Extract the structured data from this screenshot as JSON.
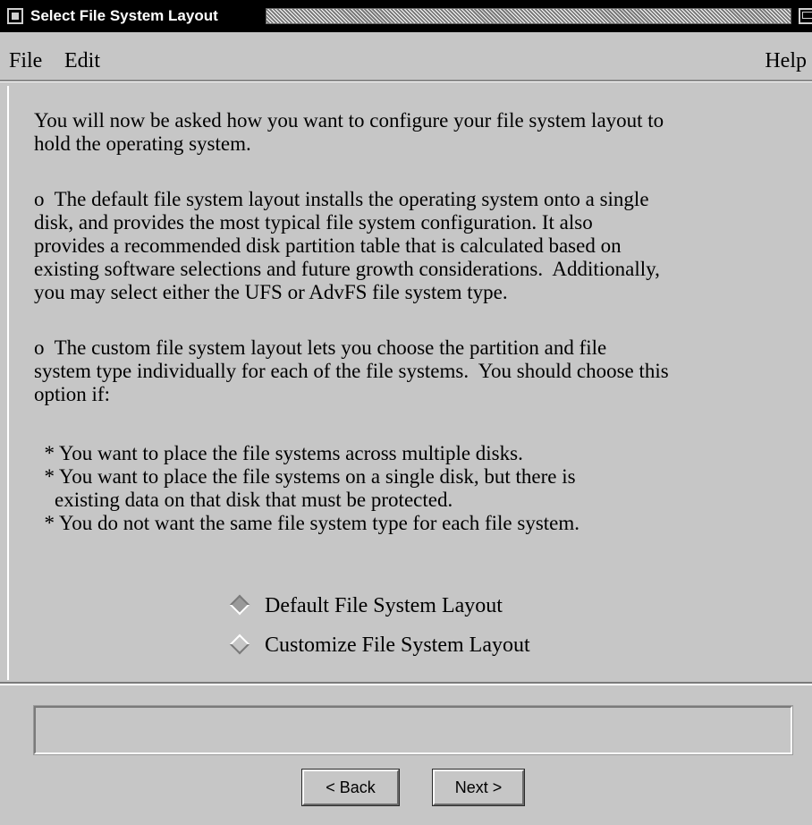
{
  "window": {
    "title": "Select File System Layout"
  },
  "menubar": {
    "file": "File",
    "edit": "Edit",
    "help": "Help"
  },
  "main": {
    "intro": "You will now be asked how you want to configure your file system layout to\nhold the operating system.",
    "default_description": "o  The default file system layout installs the operating system onto a single\ndisk, and provides the most typical file system configuration. It also\nprovides a recommended disk partition table that is calculated based on\nexisting software selections and future growth considerations.  Additionally,\nyou may select either the UFS or AdvFS file system type.",
    "custom_description": "o  The custom file system layout lets you choose the partition and file\nsystem type individually for each of the file systems.  You should choose this\noption if:",
    "custom_reasons": "  * You want to place the file systems across multiple disks.\n  * You want to place the file systems on a single disk, but there is\n    existing data on that disk that must be protected.\n  * You do not want the same file system type for each file system.",
    "options": {
      "default_label": "Default File System Layout",
      "custom_label": "Customize File System Layout",
      "selected": "default"
    }
  },
  "status": {
    "message": ""
  },
  "buttons": {
    "back": "< Back",
    "next": "Next >"
  }
}
